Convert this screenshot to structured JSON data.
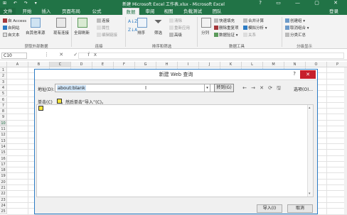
{
  "titlebar": {
    "title": "新建 Microsoft Excel 工作表.xlsx - Microsoft Excel",
    "quick_access": "⊞ ↶ ↷ ▾",
    "window_controls": "? ▭ — ▢ ✕"
  },
  "tabs": [
    "文件",
    "开始",
    "插入",
    "页面布局",
    "公式",
    "数据",
    "审阅",
    "视图",
    "负载测试",
    "团队"
  ],
  "active_tab": "数据",
  "login": "登录",
  "ribbon": {
    "get_external": {
      "items": [
        "自 Access",
        "自网站",
        "自文本"
      ],
      "other_sources": "自其他来源",
      "existing": "现有连接",
      "label": "获取外部数据"
    },
    "connections": {
      "refresh": "全部刷新",
      "items": [
        "连接",
        "属性",
        "编辑链接"
      ],
      "label": "连接"
    },
    "sort_filter": {
      "sort": "排序",
      "filter": "筛选",
      "items": [
        "清除",
        "重新应用",
        "高级"
      ],
      "label": "排序和筛选"
    },
    "data_tools": {
      "split": "分列",
      "items": [
        "快速填充",
        "删除重复项",
        "数据验证 ▾"
      ],
      "items2": [
        "合并计算",
        "模拟分析 ▾",
        "关系"
      ],
      "label": "数据工具"
    },
    "outline": {
      "items": [
        "创建组 ▾",
        "取消组合 ▾",
        "分类汇总"
      ],
      "label": "分级显示"
    }
  },
  "formula_bar": {
    "name_box": "C10",
    "icons": "⋮ ✕ ✓ fx"
  },
  "columns": [
    "A",
    "B",
    "C",
    "D",
    "E",
    "F",
    "G",
    "H",
    "I",
    "J",
    "K",
    "L",
    "M",
    "N",
    "O",
    "P"
  ],
  "rows": [
    "1",
    "2",
    "3",
    "4",
    "5",
    "6",
    "7",
    "8",
    "9",
    "10",
    "11",
    "12",
    "13",
    "14",
    "15",
    "16",
    "17",
    "18",
    "19",
    "20",
    "21",
    "22",
    "23",
    "24",
    "25"
  ],
  "dialog": {
    "title": "新建 Web 查询",
    "help": "?",
    "close": "✕",
    "address_label": "地址(D):",
    "address_value": "about:blank",
    "go_button": "转到(G)",
    "nav_icons": [
      "←",
      "→",
      "✕",
      "⟳",
      "🖫"
    ],
    "options": "选项(O)...",
    "instruction": "单击(C)",
    "instruction_tail": "，然后单击“导入”(C)。",
    "import_button": "导入(I)",
    "cancel_button": "取消"
  },
  "colors": {
    "excel_green": "#217346",
    "accent_blue": "#2b7bc4",
    "close_red": "#c7202c",
    "marker_yellow": "#f5e33a"
  }
}
